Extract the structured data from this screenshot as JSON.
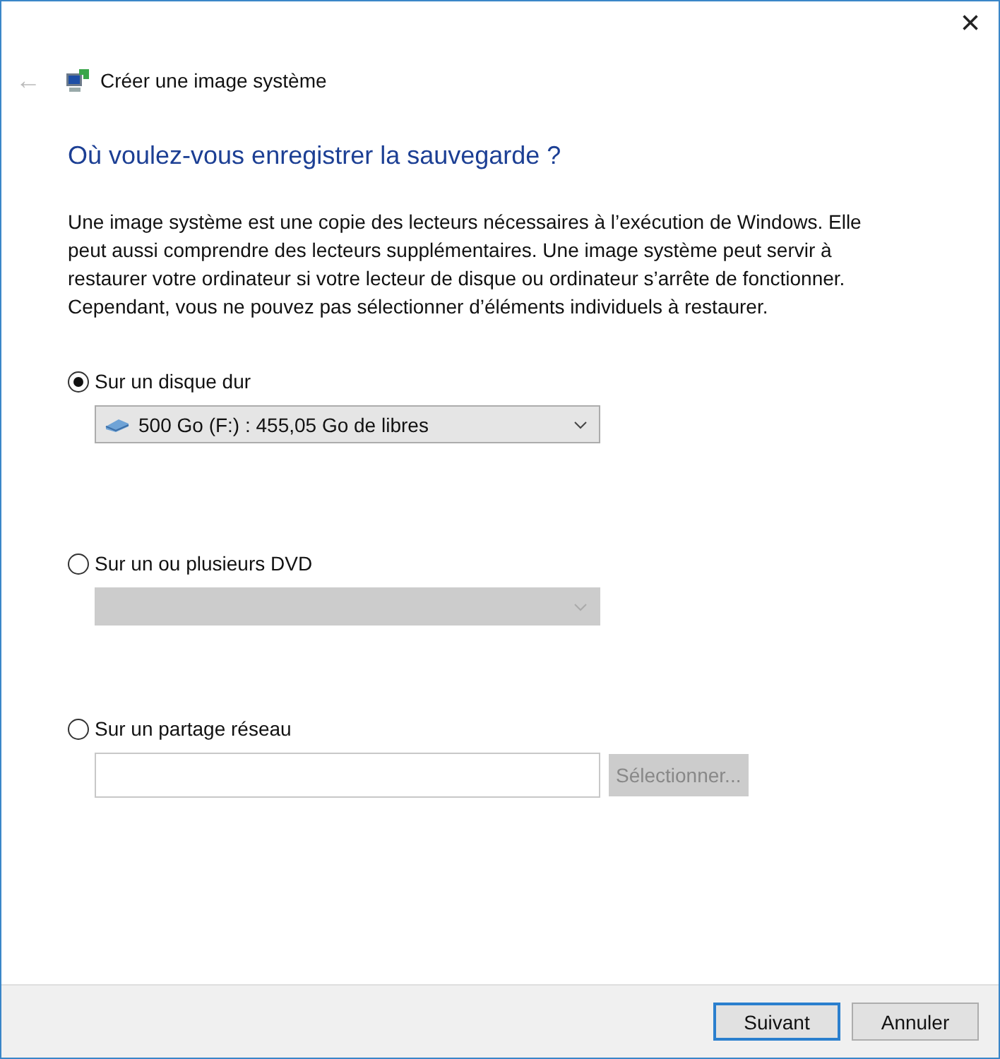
{
  "window": {
    "close": "×"
  },
  "header": {
    "back": "←",
    "title": "Créer une image système"
  },
  "heading": "Où voulez-vous enregistrer la sauvegarde ?",
  "description": "Une image système est une copie des lecteurs nécessaires à l’exécution de Windows. Elle peut aussi comprendre des lecteurs supplémentaires. Une image système peut servir à restaurer votre ordinateur si votre lecteur de disque ou ordinateur s’arrête de fonctionner. Cependant, vous ne pouvez pas sélectionner d’éléments individuels à restaurer.",
  "options": [
    {
      "kind": "combo",
      "label": "Sur un disque dur",
      "selected": true,
      "value": "500 Go (F:) : 455,05 Go de libres",
      "disabled": false
    },
    {
      "kind": "combo",
      "label": "Sur un ou plusieurs DVD",
      "selected": false,
      "disabled": true
    },
    {
      "kind": "path",
      "label": "Sur un partage réseau",
      "selected": false,
      "button": "Sélectionner...",
      "disabled": true
    }
  ],
  "buttons": [
    {
      "label": "Suivant",
      "default": true
    },
    {
      "label": "Annuler",
      "default": false
    }
  ]
}
